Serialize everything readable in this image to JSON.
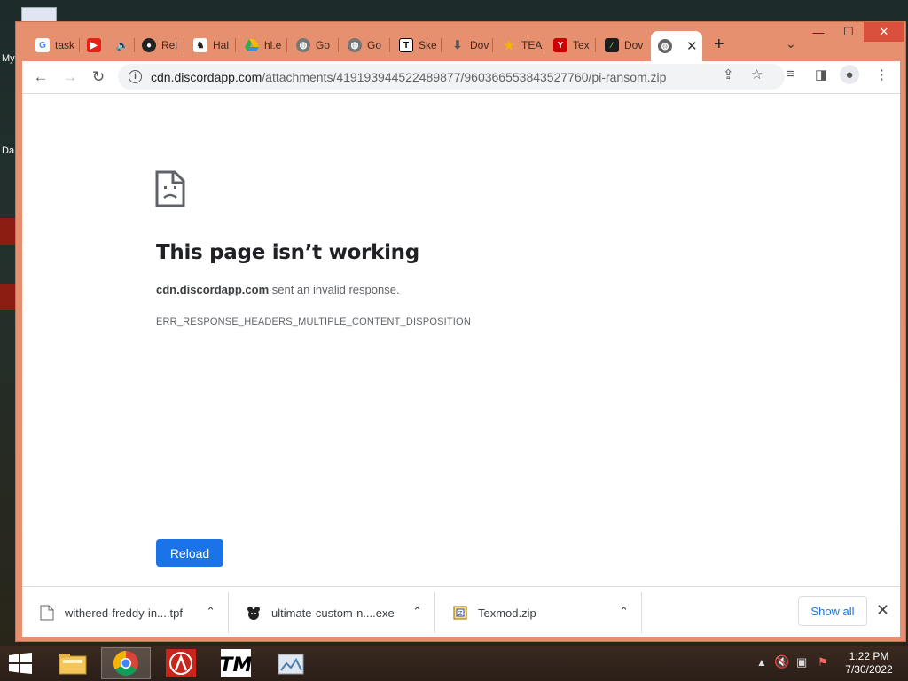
{
  "desktop": {
    "label_1": "My",
    "label_2": "Da"
  },
  "tabs": [
    {
      "label": "task",
      "icon": "google-icon"
    },
    {
      "label": "",
      "icon": "youtube-icon"
    },
    {
      "label": "",
      "icon": "speaker-icon"
    },
    {
      "label": "Rel",
      "icon": "github-icon"
    },
    {
      "label": "Hal",
      "icon": "game-icon"
    },
    {
      "label": "hl.e",
      "icon": "drive-icon"
    },
    {
      "label": "Go",
      "icon": "globe-icon"
    },
    {
      "label": "Go",
      "icon": "globe-icon"
    },
    {
      "label": "Ske",
      "icon": "t-icon"
    },
    {
      "label": "Dov",
      "icon": "download-icon"
    },
    {
      "label": "TEA",
      "icon": "star-icon"
    },
    {
      "label": "Tex",
      "icon": "wrench-icon"
    },
    {
      "label": "Dov",
      "icon": "slash-icon"
    }
  ],
  "window_controls": {
    "minimize": "—",
    "maximize": "☐",
    "close": "✕"
  },
  "toolbar": {
    "url_host": "cdn.discordapp.com",
    "url_path": "/attachments/419193944522489877/960366553843527760/pi-ransom.zip"
  },
  "error_page": {
    "title": "This page isn’t working",
    "host": "cdn.discordapp.com",
    "desc_suffix": " sent an invalid response.",
    "code": "ERR_RESPONSE_HEADERS_MULTIPLE_CONTENT_DISPOSITION",
    "reload_label": "Reload"
  },
  "downloads": [
    {
      "name": "withered-freddy-in....tpf",
      "icon": "file-icon"
    },
    {
      "name": "ultimate-custom-n....exe",
      "icon": "bear-icon"
    },
    {
      "name": "Texmod.zip",
      "icon": "zip-icon"
    }
  ],
  "shelf": {
    "show_all_label": "Show all"
  },
  "taskbar": {
    "time": "1:22 PM",
    "date": "7/30/2022"
  },
  "colors": {
    "frame": "#e7906f",
    "accent": "#1a73e8"
  }
}
